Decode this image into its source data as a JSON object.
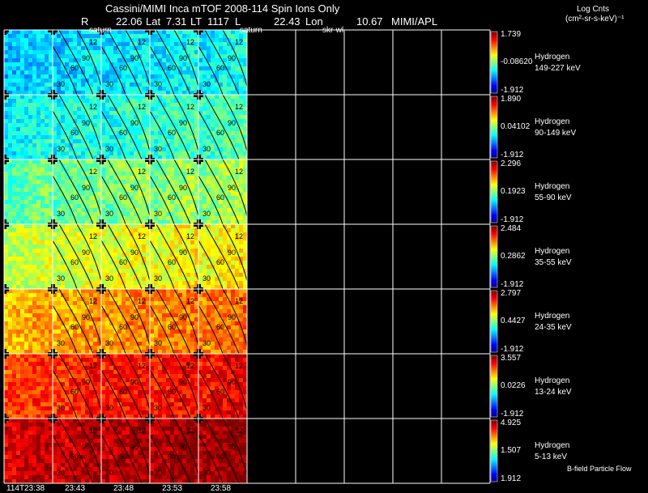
{
  "header": {
    "title_line": "Cassini/MIMI Inca mTOF  2008-114   Spin   Ions Only",
    "r_label": "R",
    "r_value": "22.06",
    "lat_label": "Lat",
    "lat_value": "7.31",
    "lt_label": "LT",
    "lt_value": "1117",
    "l_label": "L",
    "lon_value": "22.43",
    "lon_label": "Lon",
    "extra_value": "10.67",
    "org": "MIMI/APL",
    "marker_labels": [
      "saturn",
      "saturn",
      "skr-wl"
    ]
  },
  "units": {
    "line1": "Log Cnts",
    "line2": "(cm²-sr-s-keV)⁻¹"
  },
  "rows": [
    {
      "species": "Hydrogen",
      "energy": "149-227 keV",
      "max": "1.739",
      "mid": "-0.08620",
      "min": "-1.912",
      "level": 0.3
    },
    {
      "species": "Hydrogen",
      "energy": "90-149 keV",
      "max": "1.890",
      "mid": "0.04102",
      "min": "-1.912",
      "level": 0.36
    },
    {
      "species": "Hydrogen",
      "energy": "55-90 keV",
      "max": "2.296",
      "mid": "0.1923",
      "min": "-1.912",
      "level": 0.45
    },
    {
      "species": "Hydrogen",
      "energy": "35-55 keV",
      "max": "2.484",
      "mid": "0.2862",
      "min": "-1.912",
      "level": 0.55
    },
    {
      "species": "Hydrogen",
      "energy": "24-35 keV",
      "max": "2.797",
      "mid": "0.4427",
      "min": "-1.912",
      "level": 0.68
    },
    {
      "species": "Hydrogen",
      "energy": "13-24 keV",
      "max": "3.557",
      "mid": "0.0226",
      "min": "-1.912",
      "level": 0.8
    },
    {
      "species": "Hydrogen",
      "energy": "5-13 keV",
      "max": "4.925",
      "mid": "1.507",
      "min": "1.912",
      "level": 0.9
    }
  ],
  "contour_labels": [
    "12",
    "90",
    "60",
    "30"
  ],
  "time_labels": [
    "114T23:38",
    "23:43",
    "23:48",
    "23:53",
    "23:58"
  ],
  "footer_note": "B-field Particle Flow",
  "colors": {
    "background": "#000000",
    "grid": "#ffffff"
  }
}
